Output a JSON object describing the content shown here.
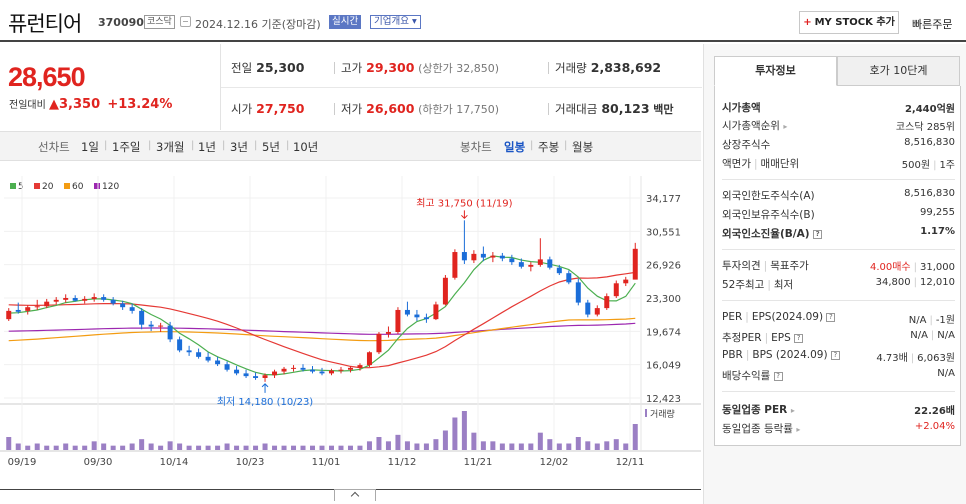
{
  "header": {
    "stock_name": "퓨런티어",
    "stock_code": "370090",
    "market": "코스닥",
    "date_text": "2024.12.16 기준(장마감)",
    "realtime_label": "실시간",
    "overview_label": "기업개요",
    "mystock_label": "MY STOCK 추가",
    "quick_order_label": "빠른주문"
  },
  "price": {
    "current": "28,650",
    "change_label": "전일대비",
    "change_amount": "3,350",
    "change_pct": "+13.24%"
  },
  "metrics": {
    "prev_label": "전일",
    "prev": "25,300",
    "high_label": "고가",
    "high": "29,300",
    "upper_label": "(상한가 32,850)",
    "volume_label": "거래량",
    "volume": "2,838,692",
    "open_label": "시가",
    "open": "27,750",
    "low_label": "저가",
    "low": "26,600",
    "lower_label": "(하한가 17,750)",
    "amount_label": "거래대금",
    "amount": "80,123",
    "amount_unit": "백만"
  },
  "range_tabs": {
    "line_label": "선차트",
    "ranges": [
      "1일",
      "1주일",
      "3개월",
      "1년",
      "3년",
      "5년",
      "10년"
    ],
    "candle_label": "봉차트",
    "candles": [
      "일봉",
      "주봉",
      "월봉"
    ],
    "active_candle": "일봉"
  },
  "chart_data": {
    "type": "candlestick",
    "legend": [
      {
        "name": "5",
        "color": "#4caf50"
      },
      {
        "name": "20",
        "color": "#e53935"
      },
      {
        "name": "60",
        "color": "#f39c12"
      },
      {
        "name": "120",
        "color": "#9c27b0"
      }
    ],
    "y_ticks": [
      "34,177",
      "30,551",
      "26,926",
      "23,300",
      "19,674",
      "16,049",
      "12,423"
    ],
    "ylim": [
      12423,
      34177
    ],
    "x_ticks": [
      "09/19",
      "09/30",
      "10/14",
      "10/23",
      "11/01",
      "11/12",
      "11/21",
      "12/02",
      "12/11"
    ],
    "volume_label": "거래량",
    "annotations": {
      "high": "최고 31,750 (11/19)",
      "low": "최저 14,180 (10/23)"
    },
    "ohlc": [
      [
        21000,
        22200,
        20800,
        21900
      ],
      [
        22000,
        22800,
        21600,
        21800
      ],
      [
        21900,
        22500,
        21500,
        22300
      ],
      [
        22300,
        23100,
        22000,
        22400
      ],
      [
        22400,
        23200,
        22200,
        22900
      ],
      [
        22900,
        23400,
        22600,
        23100
      ],
      [
        23100,
        23700,
        22800,
        23300
      ],
      [
        23300,
        23600,
        22900,
        23000
      ],
      [
        23000,
        23500,
        22700,
        23200
      ],
      [
        23200,
        23800,
        22900,
        23400
      ],
      [
        23400,
        23700,
        22900,
        23100
      ],
      [
        23100,
        23400,
        22500,
        22700
      ],
      [
        22700,
        23000,
        22000,
        22300
      ],
      [
        22300,
        22700,
        21600,
        21900
      ],
      [
        21900,
        22200,
        19900,
        20400
      ],
      [
        20400,
        20800,
        19700,
        20200
      ],
      [
        20200,
        20600,
        19600,
        20300
      ],
      [
        20300,
        20700,
        18500,
        18800
      ],
      [
        18800,
        19100,
        17400,
        17600
      ],
      [
        17600,
        18100,
        17000,
        17400
      ],
      [
        17400,
        17800,
        16700,
        16900
      ],
      [
        16900,
        17400,
        16300,
        16500
      ],
      [
        16500,
        16900,
        15900,
        16100
      ],
      [
        16100,
        16400,
        15300,
        15500
      ],
      [
        15500,
        15900,
        14900,
        15100
      ],
      [
        15100,
        15500,
        14600,
        14800
      ],
      [
        14800,
        15200,
        14400,
        14600
      ],
      [
        14600,
        15100,
        14180,
        14900
      ],
      [
        14900,
        15500,
        14600,
        15300
      ],
      [
        15300,
        15800,
        15000,
        15600
      ],
      [
        15600,
        16000,
        15300,
        15700
      ],
      [
        15700,
        16100,
        15300,
        15500
      ],
      [
        15500,
        15900,
        15100,
        15300
      ],
      [
        15300,
        15700,
        14900,
        15100
      ],
      [
        15100,
        15600,
        14900,
        15400
      ],
      [
        15400,
        15800,
        15100,
        15500
      ],
      [
        15500,
        15900,
        15200,
        15700
      ],
      [
        15700,
        16200,
        15400,
        16000
      ],
      [
        16000,
        17500,
        15800,
        17400
      ],
      [
        17400,
        19600,
        17200,
        19400
      ],
      [
        19400,
        20200,
        19000,
        19600
      ],
      [
        19600,
        22300,
        19400,
        22000
      ],
      [
        22000,
        22900,
        21300,
        21500
      ],
      [
        21500,
        22000,
        20800,
        21200
      ],
      [
        21200,
        21600,
        20600,
        21000
      ],
      [
        21000,
        22900,
        20900,
        22600
      ],
      [
        22600,
        25800,
        22500,
        25500
      ],
      [
        25500,
        28600,
        25300,
        28300
      ],
      [
        28300,
        31750,
        27000,
        27400
      ],
      [
        27400,
        28500,
        27100,
        28100
      ],
      [
        28100,
        28900,
        27300,
        27700
      ],
      [
        27700,
        28300,
        27200,
        27900
      ],
      [
        27900,
        28200,
        27300,
        27600
      ],
      [
        27600,
        28000,
        26900,
        27200
      ],
      [
        27200,
        27600,
        26500,
        26700
      ],
      [
        26700,
        27200,
        26200,
        26900
      ],
      [
        26900,
        29800,
        26700,
        27500
      ],
      [
        27500,
        27800,
        26400,
        26600
      ],
      [
        26600,
        26900,
        25800,
        26000
      ],
      [
        26000,
        26300,
        24800,
        25000
      ],
      [
        25000,
        25400,
        22500,
        22800
      ],
      [
        22800,
        23100,
        21200,
        21500
      ],
      [
        21500,
        22500,
        21300,
        22200
      ],
      [
        22200,
        23800,
        22000,
        23500
      ],
      [
        23500,
        25200,
        23300,
        24900
      ],
      [
        24900,
        25600,
        24600,
        25300
      ],
      [
        25300,
        29300,
        26600,
        28650
      ]
    ],
    "volume": [
      6,
      3,
      2,
      3,
      2,
      2,
      3,
      2,
      2,
      4,
      3,
      2,
      2,
      3,
      5,
      3,
      2,
      4,
      3,
      2,
      2,
      2,
      2,
      3,
      2,
      2,
      2,
      3,
      2,
      2,
      2,
      2,
      2,
      2,
      2,
      2,
      2,
      2,
      4,
      6,
      4,
      7,
      4,
      3,
      3,
      5,
      9,
      15,
      18,
      8,
      4,
      4,
      3,
      3,
      3,
      3,
      8,
      5,
      3,
      3,
      6,
      4,
      3,
      4,
      5,
      3,
      12
    ]
  },
  "sidebar": {
    "tab_active": "투자정보",
    "tab_inactive": "호가 10단계",
    "rows": {
      "mktcap_label": "시가총액",
      "mktcap": "2,440억원",
      "mktrank_label": "시가총액순위",
      "mktrank": "코스닥 285위",
      "shares_label": "상장주식수",
      "shares": "8,516,830",
      "par_label": "액면가",
      "trade_unit_label": "매매단위",
      "par": "500원",
      "trade_unit": "1주",
      "foreign_limit_label": "외국인한도주식수(A)",
      "foreign_limit": "8,516,830",
      "foreign_hold_label": "외국인보유주식수(B)",
      "foreign_hold": "99,255",
      "foreign_rate_label": "외국인소진율(B/A)",
      "foreign_rate": "1.17%",
      "opinion_label": "투자의견",
      "target_label": "목표주가",
      "opinion": "4.00매수",
      "target": "31,000",
      "w52_label": "52주최고",
      "w52_low_label": "최저",
      "w52_high": "34,800",
      "w52_low": "12,010",
      "per_label": "PER",
      "eps_label": "EPS(2024.09)",
      "per": "N/A",
      "eps": "-1원",
      "est_per_label": "추정PER",
      "est_eps_label": "EPS",
      "est_per": "N/A",
      "est_eps": "N/A",
      "pbr_label": "PBR",
      "bps_label": "BPS (2024.09)",
      "pbr": "4.73배",
      "bps": "6,063원",
      "div_label": "배당수익률",
      "div": "N/A",
      "sector_per_label": "동일업종 PER",
      "sector_per": "22.26배",
      "sector_rate_label": "동일업종 등락률",
      "sector_rate": "+2.04%"
    }
  }
}
